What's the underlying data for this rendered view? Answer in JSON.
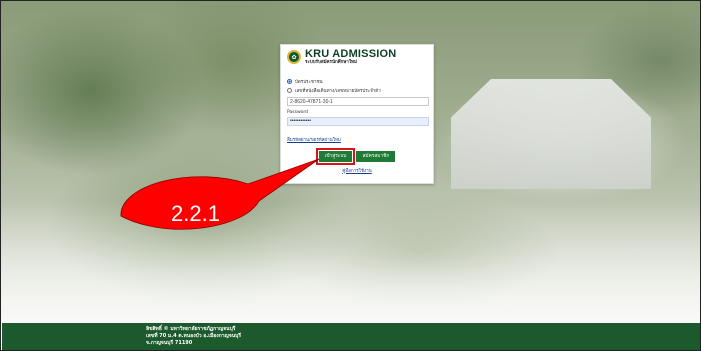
{
  "brand": {
    "title": "KRU ADMISSION",
    "subtitle": "ระบบรับสมัครนักศึกษาใหม่"
  },
  "login": {
    "option_id_card": "บัตรประชาชน",
    "option_passport": "เลขที่หนังสือเดินทาง/เลขหมายบัตรประจำตัว",
    "id_value": "2-8620-47871-30-1",
    "password_label": "Password",
    "password_value": "••••••••••••",
    "forgot_link": "ลืมรหัสผ่าน/ขอรหัสผ่านใหม่",
    "login_button": "เข้าสู่ระบบ",
    "register_button": "สมัครสมาชิก",
    "manual_link": "คู่มือการใช้งาน"
  },
  "callout": {
    "label": "2.2.1",
    "color": "#ff0000"
  },
  "footer": {
    "line1": "ลิขสิทธิ์ © มหาวิทยาลัยราชภัฏกาญจนบุรี",
    "line2": "เลขที่ 70 ม.4 ต.หนองบัว อ.เมืองกาญจนบุรี",
    "line3": "จ.กาญจนบุรี 71190"
  },
  "colors": {
    "brand_green": "#1e7a35",
    "footer_green": "#1c5a2e",
    "highlight_red": "#d61515"
  }
}
